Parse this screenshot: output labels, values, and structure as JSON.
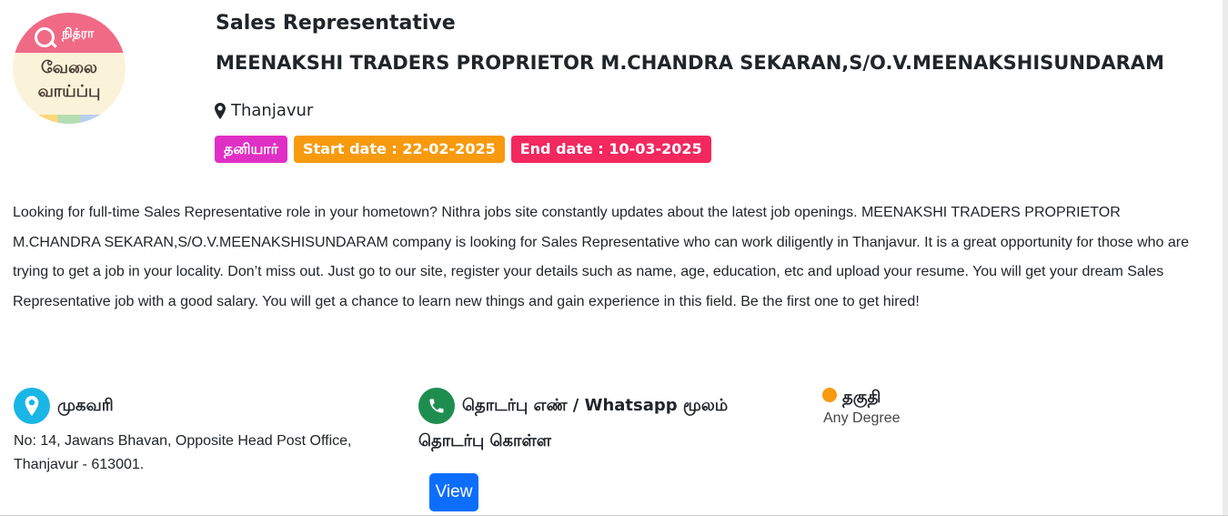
{
  "logo": {
    "brand": "நித்ரா",
    "line1": "வேலை",
    "line2": "வாய்ப்பு"
  },
  "job": {
    "title": "Sales Representative",
    "company": "MEENAKSHI TRADERS PROPRIETOR M.CHANDRA SEKARAN,S/O.V.MEENAKSHISUNDARAM",
    "location": "Thanjavur"
  },
  "badges": {
    "type": "தனியார்",
    "start": "Start date : 22-02-2025",
    "end": "End date : 10-03-2025"
  },
  "description": "Looking for full-time Sales Representative role in your hometown? Nithra jobs site constantly updates about the latest job openings. MEENAKSHI TRADERS PROPRIETOR M.CHANDRA SEKARAN,S/O.V.MEENAKSHISUNDARAM company is looking for Sales Representative who can work diligently in Thanjavur. It is a great opportunity for those who are trying to get a job in your locality. Don’t miss out. Just go to our site, register your details such as name, age, education, etc and upload your resume. You will get your dream Sales Representative job with a good salary. You will get a chance to learn new things and gain experience in this field. Be the first one to get hired!",
  "address": {
    "label": "முகவரி",
    "text": "No: 14, Jawans Bhavan, Opposite Head Post Office, Thanjavur - 613001."
  },
  "contact": {
    "label_line1": "தொடர்பு எண் / Whatsapp மூலம்",
    "label_line2": "தொடர்பு கொள்ள",
    "view_button": "View"
  },
  "qualification": {
    "label": "தகுதி",
    "value": "Any Degree"
  },
  "colors": {
    "badge_type": "#e02fc5",
    "badge_start": "#f79a0e",
    "badge_end": "#f2285f",
    "address_icon": "#19b6e6",
    "contact_icon": "#1e8e4f",
    "view_button": "#0d6efd"
  },
  "icons": {
    "location": "map-marker-icon",
    "address": "location-pin-icon",
    "contact": "phone-icon",
    "qualification": "dot-icon"
  }
}
